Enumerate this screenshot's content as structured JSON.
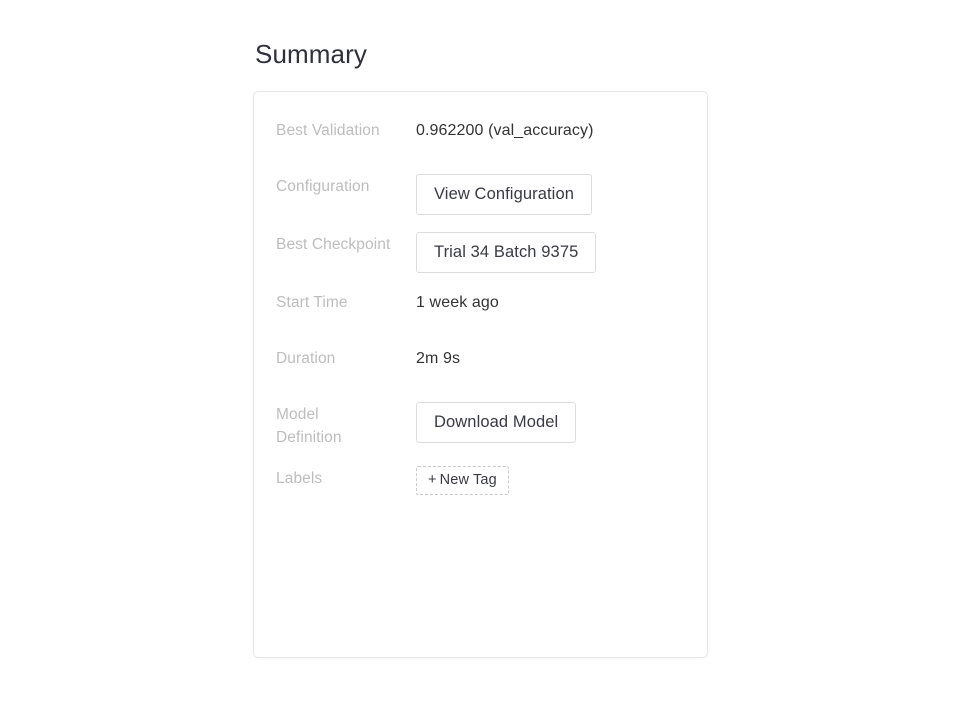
{
  "page": {
    "title": "Summary",
    "background_color": "#ffffff"
  },
  "card": {
    "border_color": "#e6e6e6",
    "background_color": "#ffffff",
    "rows": [
      {
        "key": "best_validation",
        "label": "Best Validation",
        "type": "text",
        "value": "0.962200 (val_accuracy)"
      },
      {
        "key": "configuration",
        "label": "Configuration",
        "type": "button",
        "value": "View Configuration"
      },
      {
        "key": "best_checkpoint",
        "label": "Best Checkpoint",
        "type": "button",
        "value": "Trial 34 Batch 9375"
      },
      {
        "key": "start_time",
        "label": "Start Time",
        "type": "text",
        "value": "1 week ago"
      },
      {
        "key": "duration",
        "label": "Duration",
        "type": "text",
        "value": "2m 9s"
      },
      {
        "key": "model_definition",
        "label": "Model\nDefinition",
        "type": "button",
        "value": "Download Model"
      },
      {
        "key": "labels",
        "label": "Labels",
        "type": "tag",
        "value": "New Tag",
        "prefix": "+"
      }
    ]
  },
  "colors": {
    "label_text": "#bdbdbd",
    "value_text": "#333333",
    "title_text": "#2f2f3d",
    "button_border": "#dddddd",
    "tag_border": "#c9c9c9"
  }
}
